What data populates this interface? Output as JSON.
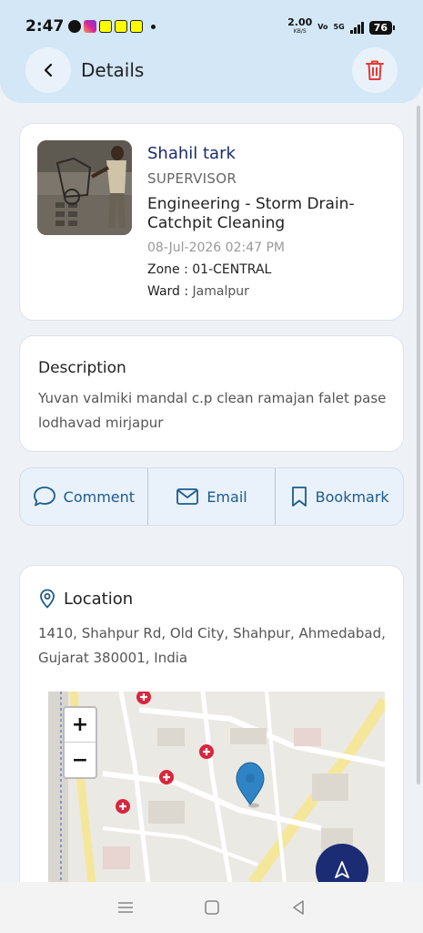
{
  "status_bar": {
    "time": "2:47",
    "speed": "2.00",
    "speed_unit": "KB/S",
    "volte": "Vo",
    "network": "5G",
    "battery": "76"
  },
  "header": {
    "title": "Details"
  },
  "complaint": {
    "name": "Shahil tark",
    "role": "SUPERVISOR",
    "category": "Engineering - Storm Drain-Catchpit Cleaning",
    "datetime": "08-Jul-2026 02:47 PM",
    "zone_label": "Zone :",
    "zone_value": "01-CENTRAL",
    "ward_label": "Ward :",
    "ward_value": "Jamalpur"
  },
  "description": {
    "heading": "Description",
    "text": "Yuvan valmiki mandal c.p clean ramajan falet pase lodhavad mirjapur"
  },
  "actions": [
    {
      "label": "Comment",
      "icon": "comment-icon"
    },
    {
      "label": "Email",
      "icon": "email-icon"
    },
    {
      "label": "Bookmark",
      "icon": "bookmark-icon"
    }
  ],
  "location": {
    "heading": "Location",
    "address": "1410, Shahpur Rd, Old City, Shahpur, Ahmedabad, Gujarat 380001, India",
    "zoom_in": "+",
    "zoom_out": "−"
  },
  "colors": {
    "header_bg": "#d3e7f6",
    "accent": "#1c5b8e",
    "delete": "#e53935",
    "fab": "#1b2c74",
    "title_name": "#1a2a6e"
  }
}
